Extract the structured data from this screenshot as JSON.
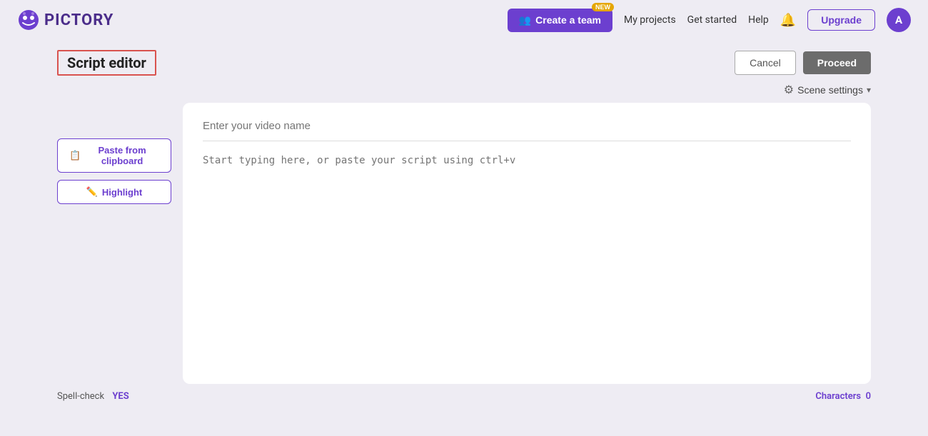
{
  "header": {
    "logo_text": "PICTORY",
    "create_team_label": "Create a team",
    "new_badge": "NEW",
    "my_projects": "My projects",
    "get_started": "Get started",
    "help": "Help",
    "upgrade_label": "Upgrade",
    "avatar_initial": "A"
  },
  "page": {
    "title": "Script editor",
    "cancel_label": "Cancel",
    "proceed_label": "Proceed",
    "scene_settings_label": "Scene settings",
    "paste_clipboard_label": "Paste from clipboard",
    "highlight_label": "Highlight",
    "video_name_placeholder": "Enter your video name",
    "script_placeholder": "Start typing here, or paste your script using ctrl+v",
    "spell_check_label": "Spell-check",
    "spell_check_value": "YES",
    "characters_label": "Characters",
    "characters_count": "0"
  }
}
